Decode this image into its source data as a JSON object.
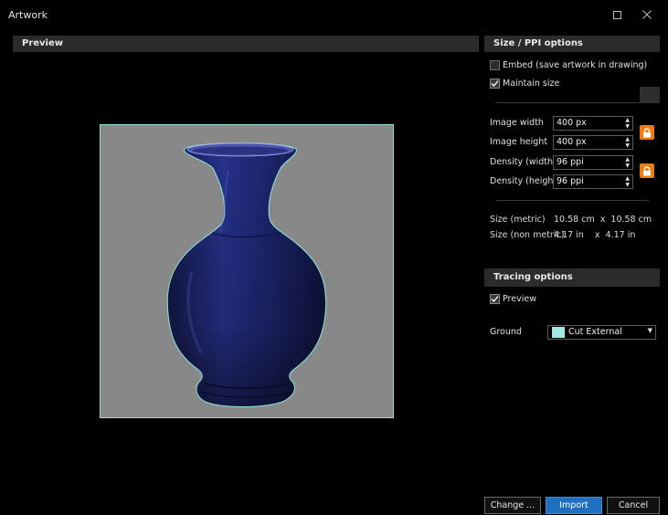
{
  "window": {
    "title": "Artwork",
    "maximize_icon": "maximize-icon",
    "close_icon": "close-icon"
  },
  "preview": {
    "header": "Preview",
    "canvas_background": "#888888",
    "outline_color": "#8de0d2",
    "vase_color": "#1c2566"
  },
  "size_options": {
    "header": "Size / PPI options",
    "embed_label": "Embed (save artwork in drawing)",
    "embed_checked": false,
    "maintain_label": "Maintain size",
    "maintain_checked": true,
    "fields": [
      {
        "label": "Image width",
        "value": "400 px"
      },
      {
        "label": "Image height",
        "value": "400 px"
      },
      {
        "label": "Density (width)",
        "value": "96 ppi"
      },
      {
        "label": "Density (height)",
        "value": "96 ppi"
      }
    ],
    "lock_color": "#f07b12",
    "size_metric_label": "Size (metric)",
    "size_metric_value": "10.58 cm  x  10.58 cm",
    "size_nonmetric_label": "Size (non metric)",
    "size_nonmetric_value": "4.17 in    x  4.17 in"
  },
  "tracing": {
    "header": "Tracing options",
    "preview_label": "Preview",
    "preview_checked": true,
    "ground_label": "Ground",
    "ground_value": "Cut External",
    "ground_swatch": "#a8e8e4"
  },
  "footer": {
    "change_label": "Change ...",
    "import_label": "Import",
    "cancel_label": "Cancel"
  }
}
